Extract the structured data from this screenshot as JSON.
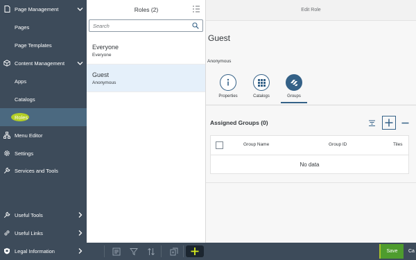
{
  "sidebar": {
    "items": [
      {
        "label": "Page Management",
        "kind": "section",
        "icon": "document-icon",
        "expanded": true
      },
      {
        "label": "Pages",
        "kind": "child"
      },
      {
        "label": "Page Templates",
        "kind": "child"
      },
      {
        "label": "Content Management",
        "kind": "section",
        "icon": "box-icon",
        "expanded": true
      },
      {
        "label": "Apps",
        "kind": "child"
      },
      {
        "label": "Catalogs",
        "kind": "child"
      },
      {
        "label": "Roles",
        "kind": "child",
        "selected": true
      },
      {
        "label": "Menu Editor",
        "kind": "section",
        "icon": "hierarchy-icon"
      },
      {
        "label": "Settings",
        "kind": "section",
        "icon": "gear-icon"
      },
      {
        "label": "Services and Tools",
        "kind": "section",
        "icon": "wrench-icon"
      }
    ],
    "bottom_items": [
      {
        "label": "Useful Tools",
        "icon": "wrench-icon"
      },
      {
        "label": "Useful Links",
        "icon": "link-icon"
      },
      {
        "label": "Legal Information",
        "icon": "shield-icon"
      }
    ]
  },
  "roles_panel": {
    "title": "Roles (2)",
    "search_placeholder": "Search",
    "items": [
      {
        "title": "Everyone",
        "subtitle": "Everyone",
        "selected": false
      },
      {
        "title": "Guest",
        "subtitle": "Anonymous",
        "selected": true
      }
    ]
  },
  "detail": {
    "header_title": "Edit Role",
    "object_title": "Guest",
    "object_subtitle": "Anonymous",
    "tabs": [
      {
        "label": "Properties",
        "icon": "info-icon",
        "active": false
      },
      {
        "label": "Catalogs",
        "icon": "grid-icon",
        "active": false
      },
      {
        "label": "Groups",
        "icon": "groups-icon",
        "active": true
      }
    ],
    "assigned_groups": {
      "title": "Assigned Groups (0)",
      "columns": [
        "Group Name",
        "Group ID",
        "Tiles"
      ],
      "empty_text": "No data"
    }
  },
  "footer": {
    "save_label": "Save",
    "cancel_label": "Ca"
  },
  "colors": {
    "sidebar_bg": "#3d4b5a",
    "sidebar_selected": "#4b6980",
    "accent": "#346187",
    "save_green": "#4e9c2e",
    "highlight_yellow": "#c5e016"
  }
}
